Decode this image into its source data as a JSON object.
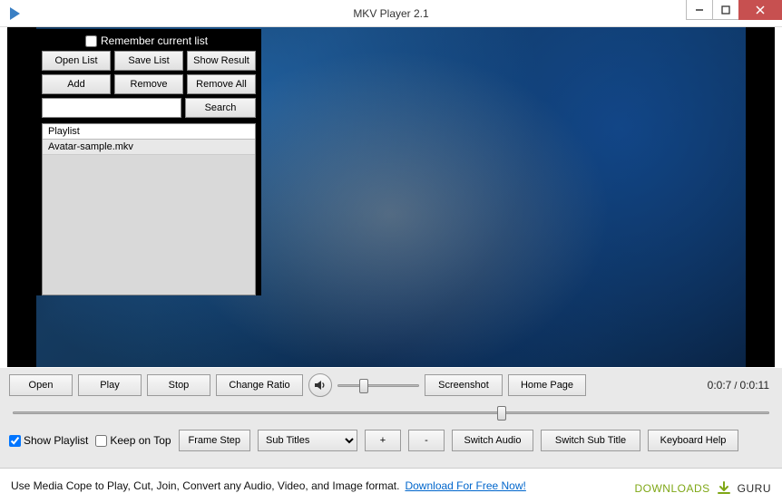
{
  "window": {
    "title": "MKV Player 2.1"
  },
  "playlist_panel": {
    "remember_label": "Remember current list",
    "remember_checked": false,
    "buttons": {
      "open_list": "Open List",
      "save_list": "Save List",
      "show_result": "Show Result",
      "add": "Add",
      "remove": "Remove",
      "remove_all": "Remove All",
      "search": "Search"
    },
    "search_value": "",
    "header": "Playlist",
    "items": [
      "Avatar-sample.mkv"
    ]
  },
  "controls": {
    "open": "Open",
    "play": "Play",
    "stop": "Stop",
    "change_ratio": "Change Ratio",
    "screenshot": "Screenshot",
    "home_page": "Home Page",
    "volume_percent": 30,
    "time_current": "0:0:7",
    "time_total": "0:0:11",
    "seek_percent": 64
  },
  "controls2": {
    "show_playlist": "Show Playlist",
    "show_playlist_checked": true,
    "keep_on_top": "Keep on Top",
    "keep_on_top_checked": false,
    "frame_step": "Frame Step",
    "subtitles_label": "Sub Titles",
    "plus": "+",
    "minus": "-",
    "switch_audio": "Switch Audio",
    "switch_subtitle": "Switch Sub Title",
    "keyboard_help": "Keyboard Help"
  },
  "footer": {
    "text": "Use Media Cope to Play, Cut, Join, Convert any Audio, Video, and Image format.",
    "link": "Download For Free Now!"
  },
  "watermark": {
    "part1": "DOWNLOADS",
    "part2": "GURU"
  }
}
